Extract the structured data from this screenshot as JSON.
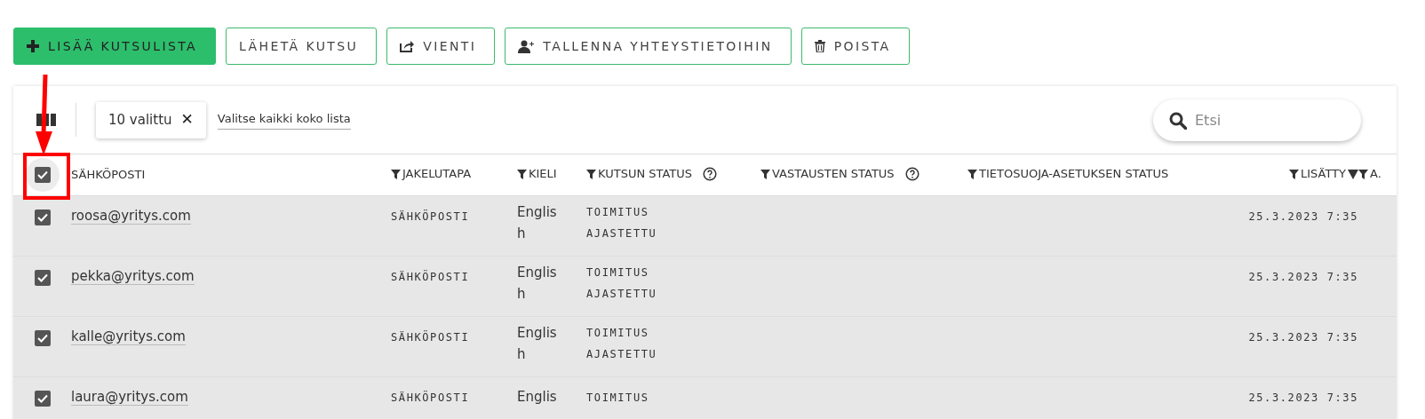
{
  "actions": [
    {
      "label": "LISÄÄ KUTSULISTA",
      "kind": "primary"
    },
    {
      "label": "LÄHETÄ KUTSU",
      "kind": "outline"
    },
    {
      "label": "VIENTI",
      "kind": "outline"
    },
    {
      "label": "TALLENNA YHTEYSTIETOIHIN",
      "kind": "outline"
    },
    {
      "label": "POISTA",
      "kind": "outline"
    }
  ],
  "toolbar": {
    "selection_chip": "10 valittu",
    "chip_close": "✕",
    "select_all_link": "Valitse kaikki koko lista",
    "search": {
      "placeholder": "Etsi"
    }
  },
  "table": {
    "all_selected": true,
    "columns": [
      {
        "label": "SÄHKÖPOSTI",
        "filter": false,
        "help": false,
        "sorted": false
      },
      {
        "label": "JAKELUTAPA",
        "filter": true,
        "help": false,
        "sorted": false
      },
      {
        "label": "KIELI",
        "filter": true,
        "help": false,
        "sorted": false
      },
      {
        "label": "KUTSUN STATUS",
        "filter": true,
        "help": true,
        "sorted": false
      },
      {
        "label": "VASTAUSTEN STATUS",
        "filter": true,
        "help": true,
        "sorted": false
      },
      {
        "label": "TIETOSUOJA-ASETUKSEN STATUS",
        "filter": true,
        "help": false,
        "sorted": false
      },
      {
        "label": "LISÄTTY",
        "filter": true,
        "help": false,
        "sorted": true
      },
      {
        "label": "A.",
        "filter": true,
        "help": false,
        "sorted": false
      }
    ],
    "rows": [
      {
        "selected": true,
        "email": "roosa@yritys.com",
        "delivery": "SÄHKÖPOSTI",
        "language": "English",
        "status": "TOIMITUS AJASTETTU",
        "added": "25.3.2023 7:35"
      },
      {
        "selected": true,
        "email": "pekka@yritys.com",
        "delivery": "SÄHKÖPOSTI",
        "language": "English",
        "status": "TOIMITUS AJASTETTU",
        "added": "25.3.2023 7:35"
      },
      {
        "selected": true,
        "email": "kalle@yritys.com",
        "delivery": "SÄHKÖPOSTI",
        "language": "English",
        "status": "TOIMITUS AJASTETTU",
        "added": "25.3.2023 7:35"
      },
      {
        "selected": true,
        "email": "laura@yritys.com",
        "delivery": "SÄHKÖPOSTI",
        "language": "Englis",
        "status": "TOIMITUS",
        "added": "25.3.2023 7:35"
      }
    ]
  },
  "annotation": {
    "kind": "arrow-box"
  }
}
